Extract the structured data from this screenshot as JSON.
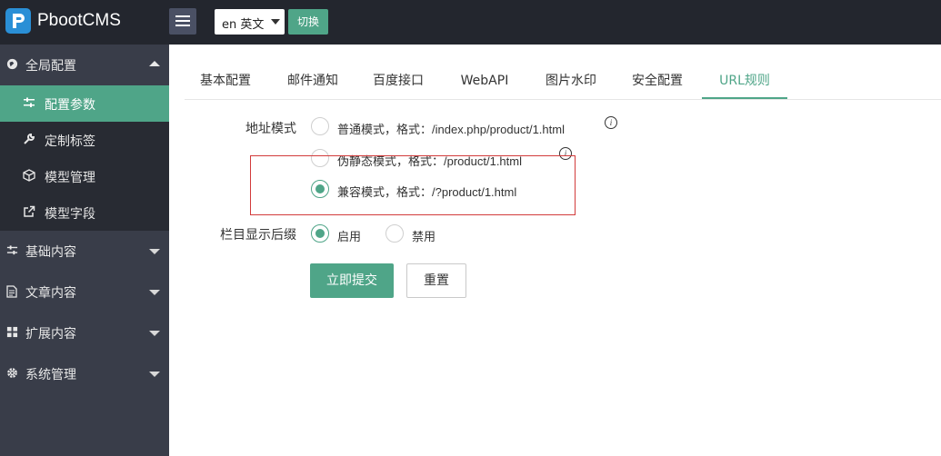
{
  "header": {
    "brand": "PbootCMS",
    "language_value": "en 英文",
    "switch_label": "切换"
  },
  "sidebar": {
    "groups": [
      {
        "label": "全局配置",
        "icon": "globe-icon",
        "expanded": true
      },
      {
        "label": "基础内容",
        "icon": "sliders-icon",
        "expanded": false
      },
      {
        "label": "文章内容",
        "icon": "document-icon",
        "expanded": false
      },
      {
        "label": "扩展内容",
        "icon": "puzzle-icon",
        "expanded": false
      },
      {
        "label": "系统管理",
        "icon": "gear-icon",
        "expanded": false
      }
    ],
    "sub_items": [
      {
        "label": "配置参数",
        "icon": "sliders-icon",
        "active": true
      },
      {
        "label": "定制标签",
        "icon": "wrench-icon",
        "active": false
      },
      {
        "label": "模型管理",
        "icon": "cube-icon",
        "active": false
      },
      {
        "label": "模型字段",
        "icon": "external-link-icon",
        "active": false
      }
    ]
  },
  "tabs": [
    {
      "label": "基本配置",
      "active": false
    },
    {
      "label": "邮件通知",
      "active": false
    },
    {
      "label": "百度接口",
      "active": false
    },
    {
      "label": "WebAPI",
      "active": false
    },
    {
      "label": "图片水印",
      "active": false
    },
    {
      "label": "安全配置",
      "active": false
    },
    {
      "label": "URL规则",
      "active": true
    }
  ],
  "form": {
    "url_mode_label": "地址模式",
    "url_mode_options": [
      {
        "label": "普通模式，格式：/index.php/product/1.html",
        "checked": false
      },
      {
        "label": "伪静态模式，格式：/product/1.html",
        "checked": false
      },
      {
        "label": "兼容模式，格式：/?product/1.html",
        "checked": true
      }
    ],
    "suffix_label": "栏目显示后缀",
    "suffix_options": [
      {
        "label": "启用",
        "checked": true
      },
      {
        "label": "禁用",
        "checked": false
      }
    ],
    "submit_label": "立即提交",
    "reset_label": "重置"
  },
  "colors": {
    "accent": "#4fa588",
    "header_bg": "#23262e",
    "sidebar_bg": "#393d49",
    "sub_bg": "#282b33",
    "highlight": "#d23b3b"
  }
}
